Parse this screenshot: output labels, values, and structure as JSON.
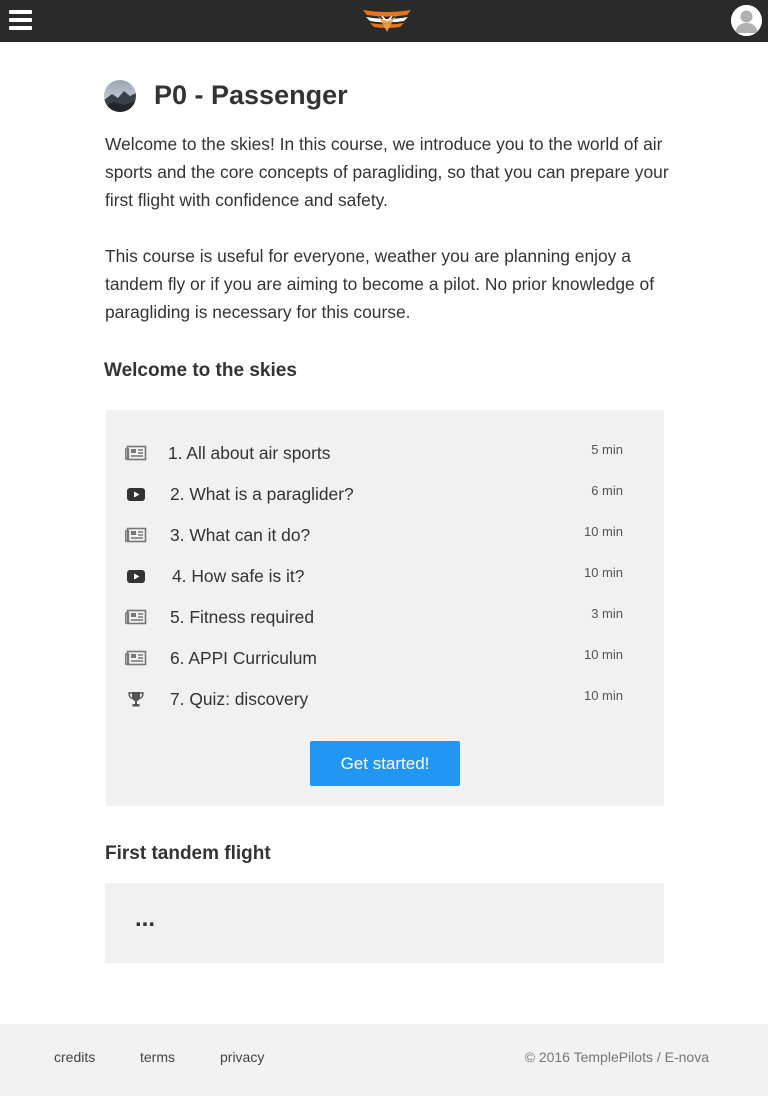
{
  "header": {
    "menu_icon": "hamburger-menu-icon",
    "logo_icon": "wings-logo",
    "user_icon": "user-avatar-icon",
    "accent": "#e8741e"
  },
  "course": {
    "title": "P0 - Passenger",
    "avatar_icon": "course-avatar-image",
    "intro_1": "Welcome to the skies! In this course, we introduce you to the world of air sports and the core concepts of paragliding, so that you can prepare your first flight with confidence and safety.",
    "intro_2": "This course is useful for everyone, weather you are planning enjoy a tandem fly or if you are aiming to become a pilot. No prior knowledge of paragliding is necessary for this course."
  },
  "sections": [
    {
      "title": "Welcome to the skies",
      "lessons": [
        {
          "label": "1. All about air sports",
          "duration": "5 min",
          "icon": "article-icon"
        },
        {
          "label": "2. What is a paraglider?",
          "duration": "6 min",
          "icon": "video-icon"
        },
        {
          "label": "3. What can it do?",
          "duration": "10 min",
          "icon": "article-icon"
        },
        {
          "label": "4. How safe is it?",
          "duration": "10 min",
          "icon": "video-icon"
        },
        {
          "label": "5. Fitness required",
          "duration": "3 min",
          "icon": "article-icon"
        },
        {
          "label": "6. APPI Curriculum",
          "duration": "10 min",
          "icon": "article-icon"
        },
        {
          "label": "7. Quiz: discovery",
          "duration": "10 min",
          "icon": "trophy-icon"
        }
      ],
      "button_label": "Get started!",
      "button_color": "#2196f3"
    },
    {
      "title": "First tandem flight",
      "placeholder": "..."
    }
  ],
  "footer": {
    "links": [
      "credits",
      "terms",
      "privacy"
    ],
    "copyright": "© 2016 TemplePilots / E-nova"
  }
}
